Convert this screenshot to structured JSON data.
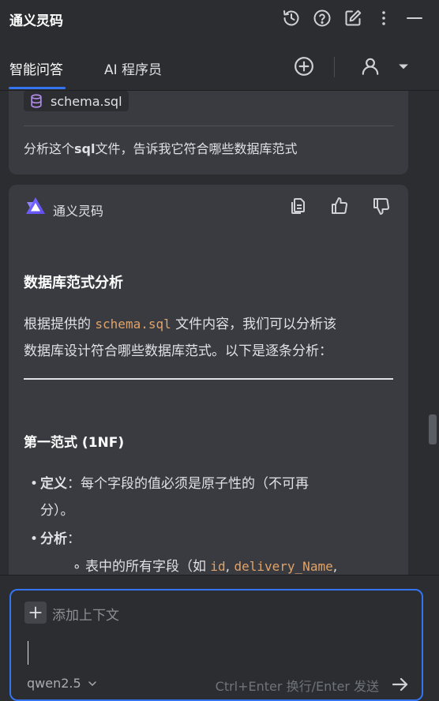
{
  "app": {
    "title": "通义灵码"
  },
  "tabs": [
    {
      "label": "智能问答",
      "active": true
    },
    {
      "label": "AI 程序员",
      "active": false
    }
  ],
  "user_message": {
    "attachment": "schema.sql",
    "question_prefix": "分析这个",
    "question_bold": "sql",
    "question_suffix": "文件，告诉我它符合哪些数据库范式"
  },
  "ai_message": {
    "sender": "通义灵码",
    "heading": "数据库范式分析",
    "intro_prefix": "根据提供的 ",
    "intro_code": "schema.sql",
    "intro_suffix": " 文件内容，我们可以分析该",
    "intro_line2": "数据库设计符合哪些数据库范式。以下是逐条分析：",
    "section_title": "第一范式 (1NF)",
    "def_label": "定义",
    "def_text": "：每个字段的值必须是原子性的（不可再",
    "def_text_line2": "分）。",
    "analysis_label": "分析",
    "analysis_colon": "：",
    "sub_prefix": "表中的所有字段（如 ",
    "sub_code1": "id",
    "sub_sep": ", ",
    "sub_code2": "delivery_Name",
    "sub_tail": ","
  },
  "input": {
    "add_context": "添加上下文",
    "model": "qwen2.5",
    "send_hint": "Ctrl+Enter 换行/Enter 发送"
  },
  "colors": {
    "accent": "#3574f0",
    "code": "#e0a369",
    "background": "#2b2d30",
    "card": "#393b40"
  }
}
